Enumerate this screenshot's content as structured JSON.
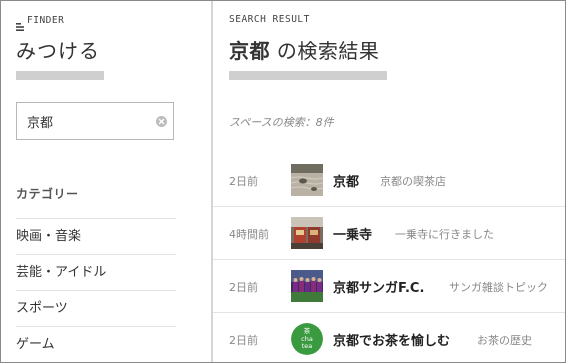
{
  "sidebar": {
    "brand_label": "FINDER",
    "brand_icon": "menu-lines-icon",
    "app_title": "みつける",
    "search": {
      "value": "京都",
      "clear_icon": "clear-circle-icon"
    },
    "category_heading": "カテゴリー",
    "categories": [
      {
        "label": "映画・音楽"
      },
      {
        "label": "芸能・アイドル"
      },
      {
        "label": "スポーツ"
      },
      {
        "label": "ゲーム"
      }
    ]
  },
  "main": {
    "eyebrow": "SEARCH RESULT",
    "title_keyword": "京都",
    "title_suffix": " の検索結果",
    "space_summary": "スペースの検索：8件",
    "results": [
      {
        "time": "2日前",
        "name": "京都",
        "desc": "京都の喫茶店",
        "thumb": "rock-garden-photo"
      },
      {
        "time": "4時間前",
        "name": "一乗寺",
        "desc": "一乗寺に行きました",
        "thumb": "storefront-photo"
      },
      {
        "time": "2日前",
        "name": "京都サンガF.C.",
        "desc": "サンガ雑談トピック",
        "thumb": "soccer-team-photo"
      },
      {
        "time": "2日前",
        "name": "京都でお茶を愉しむ",
        "desc": "お茶の歴史",
        "thumb": "tea-logo",
        "logo_lines": [
          "茶",
          "cha",
          "tea"
        ]
      }
    ]
  },
  "colors": {
    "border": "#8a8a8a",
    "divider": "#d6d6d6",
    "placeholder_bar": "#cfcfcf",
    "muted_text": "#888888",
    "tea_green": "#3a9a3f"
  }
}
